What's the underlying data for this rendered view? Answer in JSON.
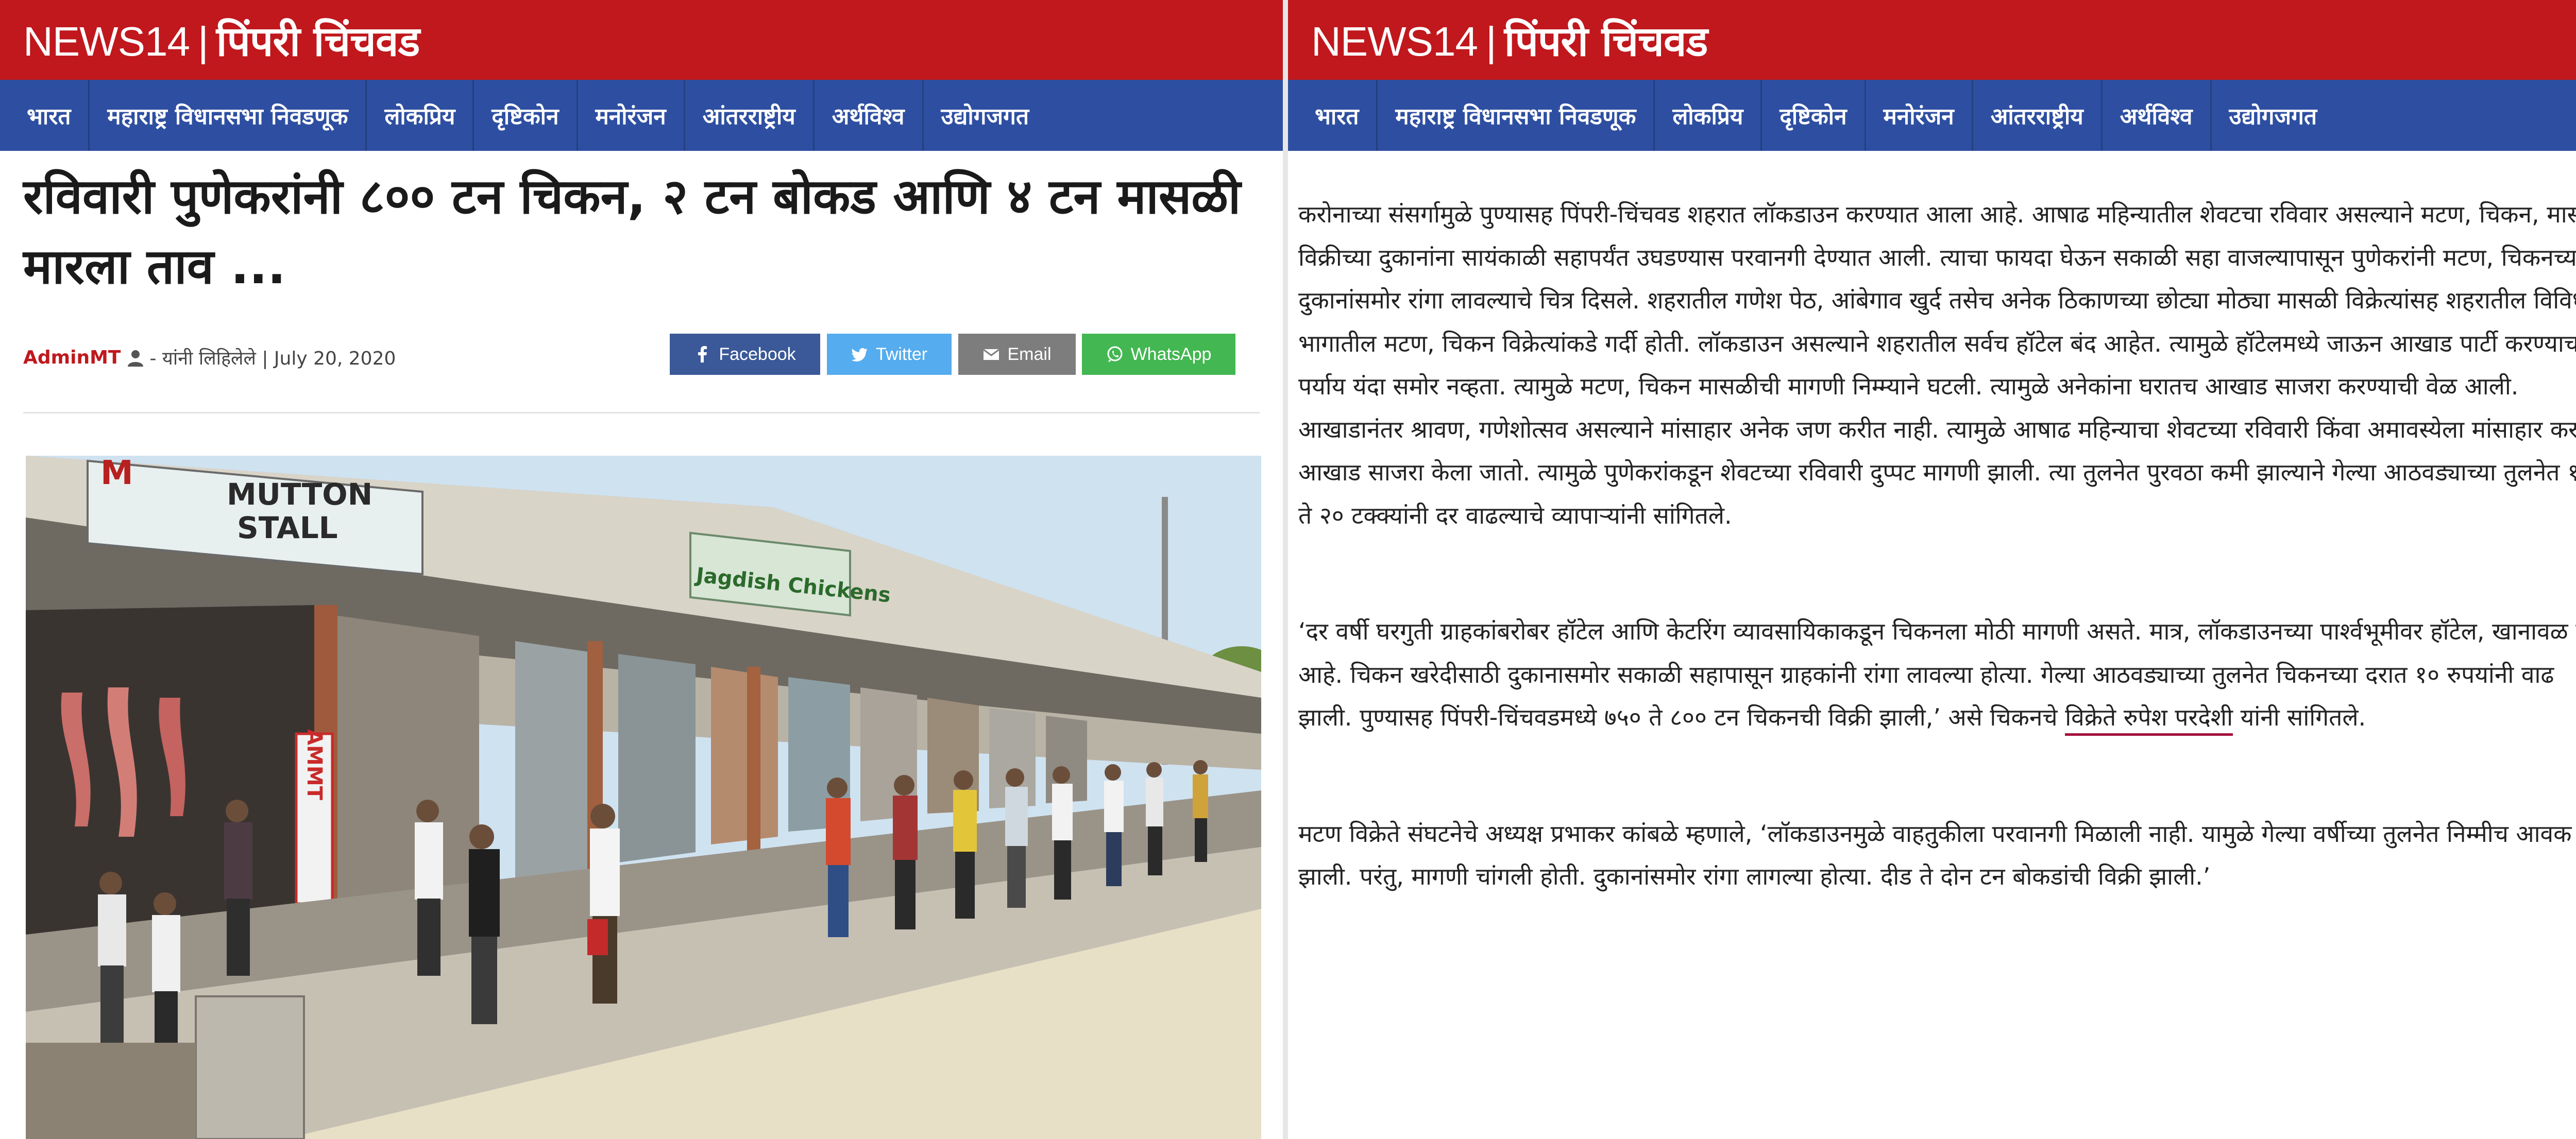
{
  "site": {
    "brand": "NEWS14",
    "separator": "|",
    "city": "पिंपरी चिंचवड"
  },
  "nav": {
    "items": [
      "भारत",
      "महाराष्ट्र विधानसभा निवडणूक",
      "लोकप्रिय",
      "दृष्टिकोन",
      "मनोरंजन",
      "आंतरराष्ट्रीय",
      "अर्थविश्व",
      "उद्योगजगत"
    ]
  },
  "article": {
    "headline": "रविवारी पुणेकरांनी ८०० टन चिकन, २ टन बोकड आणि ४ टन मासळी मारला ताव ...",
    "author": "AdminMT",
    "byline_suffix": "- यांनी लिहिलेले | July 20, 2020",
    "share": {
      "facebook": "Facebook",
      "twitter": "Twitter",
      "email": "Email",
      "whatsapp": "WhatsApp"
    },
    "photo_signs": {
      "stall_name_1": "MUTTON",
      "stall_name_2": "STALL",
      "shop_name": "Jagdish Chickens",
      "vertical_sign": "AMMT"
    },
    "paragraph_1": "करोनाच्या संसर्गामुळे पुण्यासह पिंपरी-चिंचवड शहरात लॉकडाउन करण्यात आला आहे. आषाढ महिन्यातील शेवटचा रविवार असल्याने मटण, चिकन, मासळी विक्रीच्या दुकानांना सायंकाळी सहापर्यंत उघडण्यास परवानगी देण्यात आली. त्याचा फायदा घेऊन सकाळी सहा वाजल्यापासून पुणेकरांनी मटण, चिकनच्या दुकानांसमोर रांगा लावल्याचे चित्र दिसले. शहरातील गणेश पेठ, आंबेगाव खुर्द तसेच अनेक ठिकाणच्या छोट्या मोठ्या मासळी विक्रेत्यांसह शहरातील विविध भागातील मटण, चिकन विक्रेत्यांकडे गर्दी होती. लॉकडाउन असल्याने शहरातील सर्वच हॉटेल बंद आहेत. त्यामुळे हॉटेलमध्ये जाऊन आखाड पार्टी करण्याचा पर्याय यंदा समोर नव्हता. त्यामुळे मटण, चिकन मासळीची मागणी निम्म्याने घटली. त्यामुळे अनेकांना घरातच आखाड साजरा करण्याची वेळ आली. आखाडानंतर श्रावण, गणेशोत्सव असल्याने मांसाहार अनेक जण करीत नाही. त्यामुळे आषाढ महिन्याचा शेवटच्या रविवारी किंवा अमावस्येला मांसाहार करून आखाड साजरा केला जातो. त्यामुळे पुणेकरांकडून शेवटच्या रविवारी दुप्पट मागणी झाली. त्या तुलनेत पुरवठा कमी झाल्याने गेल्या आठवड्याच्या तुलनेत १० ते २० टक्क्यांनी दर वाढल्याचे व्यापाऱ्यांनी सांगितले.",
    "paragraph_2_lead": "‘दर वर्षी घरगुती ग्राहकांबरोबर हॉटेल आणि केटरिंग व्यावसायिकाकडून चिकनला मोठी मागणी असते. मात्र, लॉकडाउनच्या पार्श्वभूमीवर हॉटेल, खानावळ बंद आहे. चिकन खरेदीसाठी दुकानासमोर सकाळी सहापासून ग्राहकांनी रांगा लावल्या होत्या. गेल्या आठवड्याच्या तुलनेत चिकनच्या दरात १० रुपयांनी वाढ झाली. पुण्यासह पिंपरी-चिंचवडमध्ये ७५० ते ८०० टन चिकनची विक्री झाली,’ असे चिकनचे ",
    "paragraph_2_link": "विक्रेते रुपेश परदेशी",
    "paragraph_2_tail": " यांनी सांगितले.",
    "paragraph_3": "मटण विक्रेते संघटनेचे अध्यक्ष प्रभाकर कांबळे म्हणाले, ‘लॉकडाउनमुळे वाहतुकीला परवानगी मिळाली नाही. यामुळे गेल्या वर्षीच्या तुलनेत निम्मीच आवक झाली. परंतु, मागणी चांगली होती. दुकानांसमोर रांगा लागल्या होत्या. दीड ते दोन टन बोकडांची विक्री झाली.’"
  },
  "colors": {
    "header_red": "#c0181d",
    "nav_blue": "#2e4fa1",
    "facebook": "#3b5998",
    "twitter": "#55acee",
    "email": "#7d7d7d",
    "whatsapp": "#43b751",
    "link_underline": "#a3123e"
  },
  "icons": [
    "user-icon",
    "facebook-icon",
    "twitter-icon",
    "email-icon",
    "whatsapp-icon"
  ]
}
